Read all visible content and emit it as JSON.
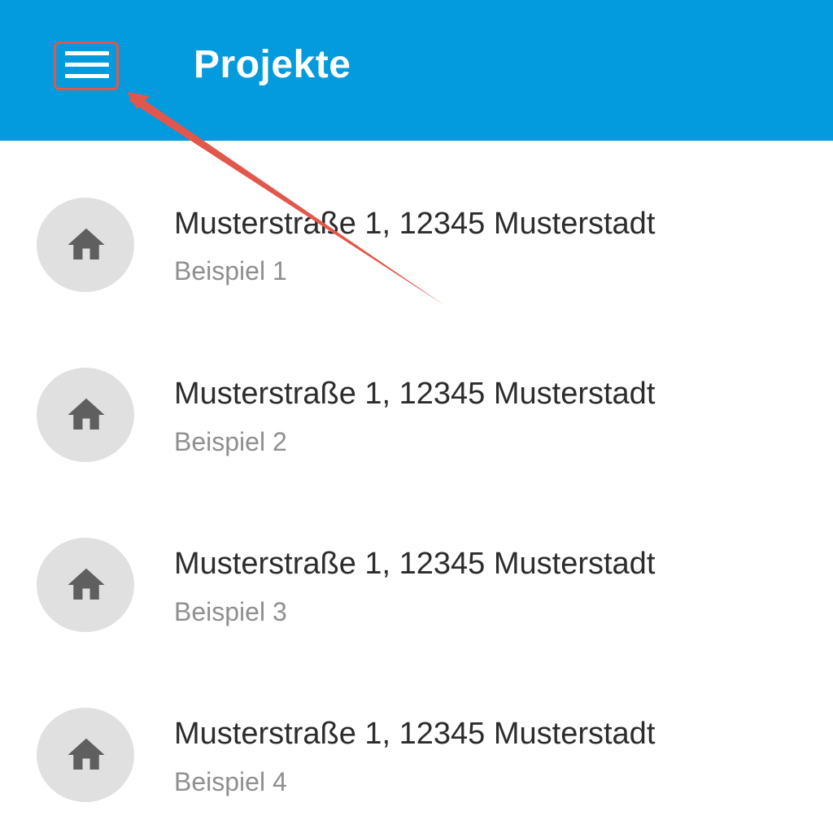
{
  "header": {
    "title": "Projekte",
    "menu_icon": "hamburger-menu-icon",
    "background_color": "#039BDD",
    "highlight_color": "#E2574C"
  },
  "projects": [
    {
      "address": "Musterstraße 1, 12345 Musterstadt",
      "label": "Beispiel 1",
      "icon": "home-icon"
    },
    {
      "address": "Musterstraße 1, 12345 Musterstadt",
      "label": "Beispiel 2",
      "icon": "home-icon"
    },
    {
      "address": "Musterstraße 1, 12345 Musterstadt",
      "label": "Beispiel 3",
      "icon": "home-icon"
    },
    {
      "address": "Musterstraße 1, 12345 Musterstadt",
      "label": "Beispiel 4",
      "icon": "home-icon"
    }
  ],
  "annotation": {
    "type": "arrow",
    "target": "menu-button",
    "color": "#E2574C"
  }
}
